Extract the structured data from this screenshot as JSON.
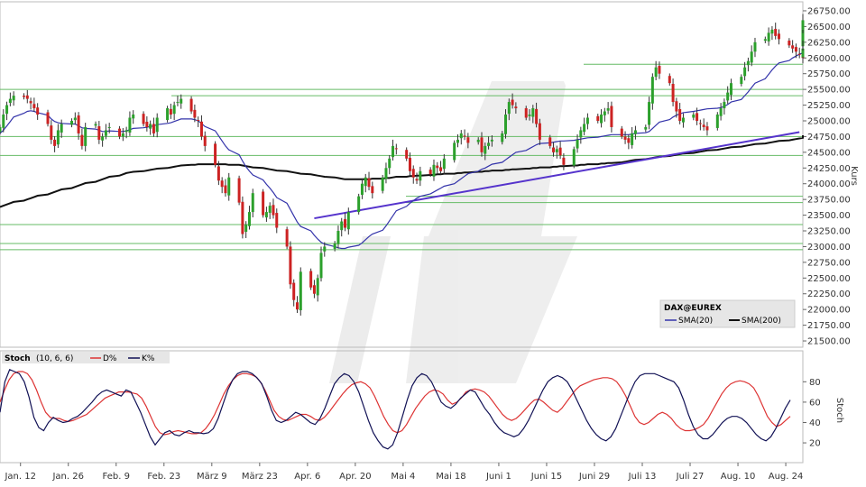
{
  "chart_data": [
    {
      "type": "candlestick",
      "instrument": "DAX@EUREX",
      "ylabel": "Kurs",
      "ylim": [
        21400,
        26850
      ],
      "yticks": [
        21500,
        21750,
        22000,
        22250,
        22500,
        22750,
        23000,
        23250,
        23500,
        23750,
        24000,
        24250,
        24500,
        24750,
        25000,
        25250,
        25500,
        25750,
        26000,
        26250,
        26500,
        26750
      ],
      "ytick_labels": [
        "21500.00",
        "21750.00",
        "22000.00",
        "22250.00",
        "22500.00",
        "22750.00",
        "23000.00",
        "23250.00",
        "23500.00",
        "23750.00",
        "24000.00",
        "24250.00",
        "24500.00",
        "24750.00",
        "25000.00",
        "25250.00",
        "25500.00",
        "25750.00",
        "26000.00",
        "26250.00",
        "26500.00",
        "26750.00"
      ],
      "x_range": [
        "2025-01-06",
        "2025-08-29"
      ],
      "xticks": [
        "2025-01-12",
        "2025-01-26",
        "2025-02-09",
        "2025-02-23",
        "2025-03-09",
        "2025-03-23",
        "2025-04-06",
        "2025-04-20",
        "2025-05-04",
        "2025-05-18",
        "2025-06-01",
        "2025-06-15",
        "2025-06-29",
        "2025-07-13",
        "2025-07-27",
        "2025-08-10",
        "2025-08-24"
      ],
      "xtick_labels": [
        "Jan. 12",
        "Jan. 26",
        "Feb. 9",
        "Feb. 23",
        "März 9",
        "März 23",
        "Apr. 6",
        "Apr. 20",
        "Mai 4",
        "Mai 18",
        "Juni 1",
        "Juni 15",
        "Juni 29",
        "Juli 13",
        "Juli 27",
        "Aug. 10",
        "Aug. 24"
      ],
      "close": [
        24900,
        25100,
        25250,
        25350,
        25400,
        25380,
        25350,
        25280,
        25200,
        25100,
        24950,
        24700,
        24600,
        24850,
        24950,
        25000,
        25050,
        24800,
        24600,
        24900,
        24950,
        24700,
        24750,
        24850,
        24900,
        24750,
        24800,
        24850,
        25050,
        25100,
        24950,
        24900,
        24950,
        24800,
        25050,
        25200,
        25100,
        25250,
        25300,
        25350,
        25150,
        25050,
        25000,
        24750,
        24600,
        24300,
        24050,
        23950,
        23850,
        24100,
        23700,
        23200,
        23350,
        23550,
        23850,
        23500,
        23550,
        23650,
        23500,
        23300,
        23000,
        22400,
        22150,
        22000,
        22600,
        22350,
        22250,
        22500,
        22900,
        23000,
        23050,
        23250,
        23400,
        23300,
        23550,
        23800,
        24000,
        24100,
        23950,
        23850,
        24100,
        24250,
        24400,
        24600,
        24550,
        24400,
        24200,
        24100,
        24050,
        24200,
        24150,
        24300,
        24250,
        24200,
        24400,
        24650,
        24700,
        24800,
        24750,
        24650,
        24700,
        24500,
        24600,
        24650,
        24700,
        24800,
        25100,
        25300,
        25250,
        25200,
        25050,
        25100,
        25200,
        24950,
        24700,
        24600,
        24500,
        24550,
        24450,
        24300,
        24550,
        24700,
        24850,
        24950,
        25050,
        25000,
        25100,
        25150,
        25200,
        24900,
        24750,
        24700,
        24650,
        24800,
        24850,
        24900,
        25300,
        25700,
        25850,
        25750,
        25600,
        25300,
        25150,
        25000,
        25050,
        25100,
        25000,
        24950,
        24900,
        24850,
        25100,
        25200,
        25300,
        25450,
        25600,
        25700,
        25850,
        25950,
        26100,
        26250,
        26300,
        26400,
        26450,
        26350,
        26300,
        26200,
        26150,
        26100,
        26050,
        26000,
        26150,
        26300,
        26450,
        26600
      ],
      "sma20": [
        24800,
        24850,
        24920,
        24990,
        25060,
        25120,
        25150,
        25160,
        25150,
        25130,
        25090,
        25030,
        24990,
        24970,
        24960,
        24950,
        24950,
        24920,
        24890,
        24880,
        24870,
        24850,
        24830,
        24830,
        24840,
        24830,
        24830,
        24840,
        24860,
        24880,
        24890,
        24900,
        24910,
        24920,
        24940,
        24960,
        24970,
        24990,
        25010,
        25030,
        25030,
        25020,
        25000,
        24960,
        24910,
        24840,
        24760,
        24680,
        24600,
        24540,
        24460,
        24360,
        24270,
        24200,
        24140,
        24060,
        23990,
        23930,
        23860,
        23780,
        23690,
        23590,
        23490,
        23390,
        23320,
        23250,
        23180,
        23120,
        23070,
        23040,
        23000,
        22980,
        22970,
        22970,
        22990,
        23020,
        23060,
        23110,
        23160,
        23200,
        23260,
        23330,
        23410,
        23490,
        23570,
        23640,
        23690,
        23730,
        23770,
        23800,
        23840,
        23870,
        23900,
        23930,
        23960,
        24000,
        24040,
        24080,
        24120,
        24160,
        24200,
        24230,
        24250,
        24280,
        24310,
        24340,
        24380,
        24420,
        24460,
        24500,
        24530,
        24560,
        24590,
        24620,
        24640,
        24650,
        24660,
        24670,
        24680,
        24680,
        24690,
        24700,
        24710,
        24720,
        24730,
        24740,
        24750,
        24760,
        24770,
        24780,
        24780,
        24780,
        24780,
        24790,
        24800,
        24810,
        24830,
        24880,
        24930,
        24980,
        25020,
        25060,
        25090,
        25110,
        25130,
        25150,
        25160,
        25170,
        25180,
        25190,
        25200,
        25210,
        25230,
        25260,
        25300,
        25340,
        25400,
        25460,
        25530,
        25600,
        25670,
        25740,
        25810,
        25870,
        25920,
        25960,
        26000,
        26030,
        26060,
        26080,
        26110,
        26140,
        26180,
        26230
      ],
      "sma200": [
        23630,
        23650,
        23670,
        23690,
        23710,
        23730,
        23750,
        23770,
        23790,
        23810,
        23830,
        23850,
        23870,
        23890,
        23910,
        23930,
        23950,
        23970,
        23990,
        24010,
        24030,
        24050,
        24070,
        24090,
        24110,
        24130,
        24150,
        24170,
        24180,
        24190,
        24200,
        24210,
        24220,
        24230,
        24240,
        24250,
        24260,
        24270,
        24280,
        24290,
        24300,
        24300,
        24310,
        24310,
        24310,
        24310,
        24310,
        24310,
        24310,
        24300,
        24300,
        24290,
        24280,
        24270,
        24260,
        24250,
        24240,
        24230,
        24220,
        24210,
        24200,
        24190,
        24180,
        24170,
        24160,
        24150,
        24140,
        24130,
        24120,
        24110,
        24100,
        24090,
        24080,
        24070,
        24070,
        24070,
        24070,
        24070,
        24070,
        24080,
        24080,
        24090,
        24090,
        24100,
        24110,
        24110,
        24120,
        24120,
        24130,
        24130,
        24140,
        24140,
        24150,
        24150,
        24160,
        24160,
        24170,
        24170,
        24180,
        24180,
        24190,
        24190,
        24200,
        24200,
        24210,
        24210,
        24220,
        24220,
        24230,
        24230,
        24240,
        24240,
        24250,
        24250,
        24260,
        24260,
        24270,
        24270,
        24280,
        24280,
        24290,
        24290,
        24300,
        24300,
        24310,
        24310,
        24320,
        24320,
        24330,
        24330,
        24340,
        24350,
        24360,
        24370,
        24380,
        24390,
        24400,
        24410,
        24420,
        24430,
        24440,
        24450,
        24460,
        24470,
        24480,
        24490,
        24500,
        24510,
        24520,
        24530,
        24540,
        24550,
        24560,
        24570,
        24580,
        24590,
        24600,
        24610,
        24620,
        24630,
        24640,
        24650,
        24660,
        24670,
        24680,
        24690,
        24700,
        24710,
        24720,
        24730,
        24740,
        24750,
        24760,
        24770
      ],
      "horizontal_levels": [
        25900,
        25500,
        25400,
        24750,
        24450,
        23800,
        23700,
        23350,
        23050,
        22950
      ],
      "trendline": {
        "from": [
          "2025-04-08",
          23450
        ],
        "to": [
          "2025-08-28",
          24820
        ]
      },
      "legend": {
        "title": "DAX@EUREX",
        "series": [
          {
            "name": "SMA(20)",
            "color": "#3333aa"
          },
          {
            "name": "SMA(200)",
            "color": "#111111"
          }
        ],
        "placement": "bottom-right"
      },
      "colors": {
        "up": "#2ca02c",
        "down": "#cc2222",
        "levels": "#66bb66",
        "trendline": "#5533cc"
      }
    },
    {
      "type": "line",
      "title": "Stoch",
      "params": "(10, 6, 6)",
      "ylabel": "Stoch",
      "ylim": [
        5,
        98
      ],
      "yticks": [
        20,
        40,
        60,
        80
      ],
      "ytick_labels": [
        "20",
        "40",
        "60",
        "80"
      ],
      "series": [
        {
          "name": "D%",
          "color": "#dd3333",
          "values": [
            60,
            72,
            82,
            88,
            90,
            90,
            88,
            82,
            72,
            60,
            50,
            45,
            44,
            44,
            42,
            41,
            42,
            44,
            46,
            48,
            52,
            56,
            60,
            64,
            66,
            68,
            70,
            70,
            70,
            69,
            68,
            64,
            56,
            46,
            36,
            30,
            28,
            29,
            31,
            32,
            31,
            30,
            29,
            29,
            30,
            34,
            40,
            48,
            58,
            68,
            76,
            82,
            86,
            88,
            88,
            87,
            85,
            80,
            72,
            62,
            52,
            46,
            43,
            42,
            44,
            46,
            48,
            48,
            46,
            43,
            42,
            45,
            50,
            56,
            62,
            68,
            73,
            77,
            79,
            80,
            78,
            74,
            66,
            56,
            46,
            38,
            32,
            30,
            32,
            38,
            46,
            54,
            60,
            66,
            70,
            72,
            71,
            68,
            62,
            58,
            60,
            64,
            70,
            72,
            73,
            72,
            70,
            66,
            60,
            54,
            48,
            44,
            42,
            44,
            48,
            53,
            58,
            62,
            63,
            60,
            56,
            52,
            50,
            54,
            60,
            66,
            72,
            76,
            78,
            80,
            82,
            83,
            84,
            84,
            83,
            80,
            74,
            66,
            56,
            46,
            40,
            38,
            40,
            44,
            48,
            50,
            48,
            44,
            38,
            34,
            32,
            32,
            33,
            35,
            38,
            44,
            52,
            60,
            68,
            74,
            78,
            80,
            81,
            80,
            78,
            74,
            66,
            56,
            46,
            40,
            36,
            38,
            42,
            46
          ]
        },
        {
          "name": "K%",
          "color": "#111155",
          "values": [
            50,
            80,
            92,
            90,
            88,
            80,
            65,
            45,
            35,
            32,
            40,
            45,
            42,
            40,
            41,
            44,
            46,
            50,
            55,
            60,
            66,
            70,
            72,
            70,
            68,
            66,
            72,
            70,
            60,
            50,
            38,
            26,
            18,
            24,
            30,
            32,
            28,
            27,
            30,
            32,
            30,
            30,
            29,
            30,
            34,
            44,
            58,
            72,
            82,
            88,
            90,
            90,
            88,
            84,
            78,
            66,
            52,
            42,
            40,
            42,
            46,
            50,
            48,
            44,
            40,
            38,
            44,
            54,
            66,
            78,
            84,
            88,
            86,
            80,
            70,
            56,
            42,
            30,
            22,
            16,
            14,
            18,
            30,
            46,
            62,
            76,
            84,
            88,
            86,
            80,
            70,
            60,
            56,
            54,
            58,
            64,
            68,
            72,
            70,
            62,
            54,
            48,
            40,
            34,
            30,
            28,
            26,
            28,
            34,
            42,
            52,
            62,
            72,
            80,
            84,
            86,
            84,
            80,
            72,
            62,
            52,
            42,
            34,
            28,
            24,
            22,
            26,
            34,
            46,
            58,
            70,
            80,
            86,
            88,
            88,
            88,
            86,
            84,
            82,
            80,
            74,
            62,
            48,
            36,
            28,
            24,
            24,
            28,
            34,
            40,
            44,
            46,
            46,
            44,
            40,
            34,
            28,
            24,
            22,
            26,
            34,
            44,
            54,
            62
          ]
        }
      ],
      "legend": {
        "placement": "top-left"
      }
    }
  ]
}
